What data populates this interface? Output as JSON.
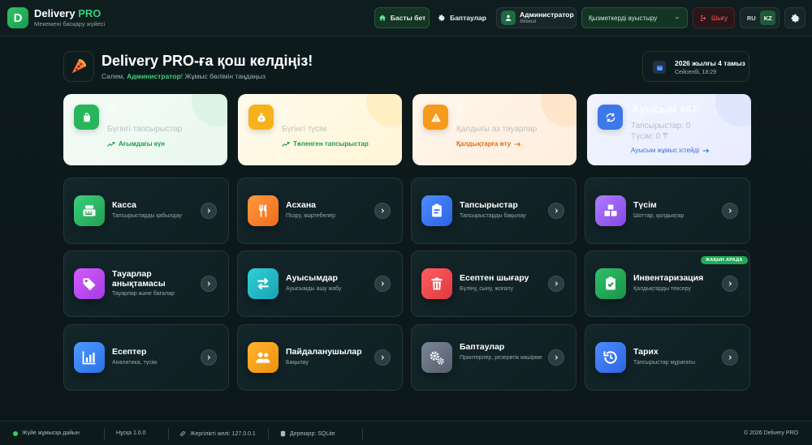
{
  "header": {
    "logo_letter": "D",
    "app_name": "Delivery",
    "app_name_accent": "PRO",
    "app_subtitle": "Мекемені басқару жүйесі",
    "home_label": "Басты бет",
    "settings_label": "Баптаулар",
    "user_name": "Администратор",
    "user_role": "Әкімші",
    "staff_select": "Қызметкерді ауыстыру",
    "logout_label": "Шығу",
    "lang_ru": "RU",
    "lang_kz": "KZ"
  },
  "welcome": {
    "title": "Delivery PRO-ға қош келдіңіз!",
    "greeting_pre": "Сәлем, ",
    "greeting_user": "Администратор",
    "greeting_post": "! Жұмыс бөлімін таңдаңыз",
    "date": "2026 жылғы 4 тамыз",
    "time": "Сейсенбі, 18:29"
  },
  "stats": [
    {
      "value": "0",
      "label": "Бүгінгі тапсырыстар",
      "link": "Ағымдағы күн"
    },
    {
      "value": "0",
      "label": "Бүгінгі түсім",
      "link": "Төленген тапсырыстар"
    },
    {
      "value": "0",
      "label": "Қалдығы аз тауарлар",
      "link": "Қалдықтарға өту"
    },
    {
      "value": "Ауысым #47",
      "line1": "Тапсырыстар: 0",
      "line2": "Түсім: 0 ₸",
      "link": "Ауысым жұмыс істейді"
    }
  ],
  "tiles": [
    {
      "name": "Касса",
      "desc": "Тапсырыстарды қабылдау"
    },
    {
      "name": "Асхана",
      "desc": "Пісіру, мәртебелер"
    },
    {
      "name": "Тапсырыстар",
      "desc": "Тапсырыстарды бақылау"
    },
    {
      "name": "Түсім",
      "desc": "Шоттар, қалдықтар"
    },
    {
      "name": "Тауарлар анықтамасы",
      "desc": "Тауарлар және бағалар"
    },
    {
      "name": "Ауысымдар",
      "desc": "Ауысымды ашу жабу"
    },
    {
      "name": "Есептен шығару",
      "desc": "Бүліну, сыну, жоғалу"
    },
    {
      "name": "Инвентаризация",
      "desc": "Қалдықтарды тексеру",
      "badge": "ЖАҚЫН АРАДА"
    },
    {
      "name": "Есептер",
      "desc": "Аналитика, түсім"
    },
    {
      "name": "Пайдаланушылар",
      "desc": "Бақылау"
    },
    {
      "name": "Баптаулар",
      "desc": "Принтерлер, резервтік көшірме"
    },
    {
      "name": "Тарих",
      "desc": "Тапсырыстар мұрағаты"
    }
  ],
  "footer": {
    "status": "Жүйе жұмысқа дайын",
    "version": "Нұсқа 1.0.0",
    "network": "Жергілікті желі: 127.0.0.1",
    "db": "Дерекқор: SQLite",
    "copyright": "© 2026 Delivery PRO"
  }
}
